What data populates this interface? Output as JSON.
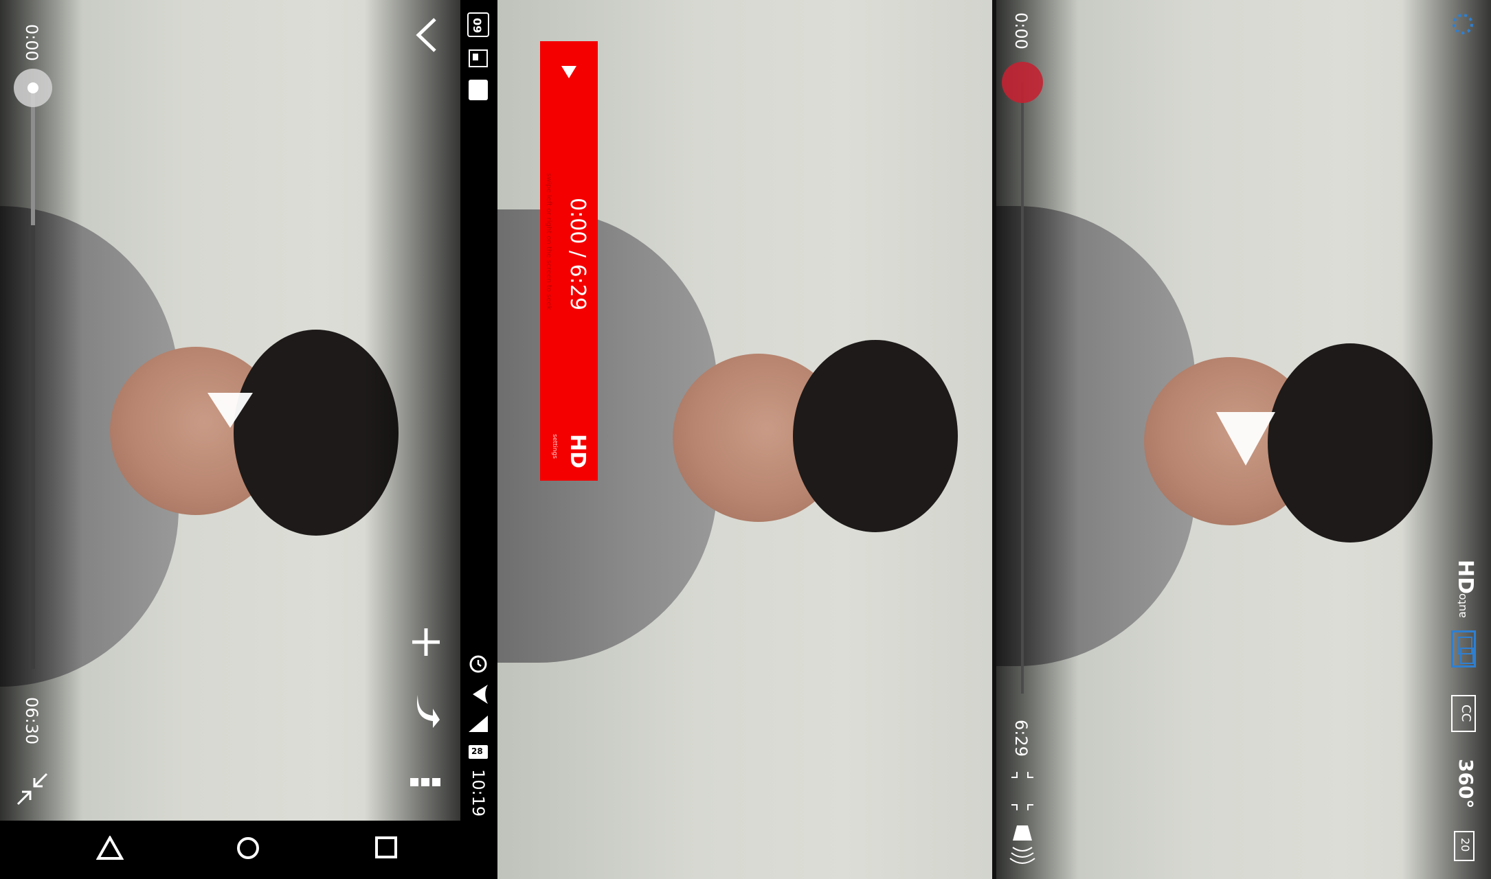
{
  "panel1": {
    "time_start": "0:00",
    "time_end": "06:30"
  },
  "panel2": {
    "status_time": "10:19",
    "status_date": "09",
    "battery": "28",
    "time_display": "0:00 / 6:29",
    "hint": "swipe left or right on the screen to seek",
    "hd_label": "HD",
    "hd_sub": "settings",
    "accent": "#f40000"
  },
  "panel3": {
    "time_start": "0:00",
    "time_end": "6:29",
    "hd_label": "HD",
    "hd_sub": "auto",
    "cc_label": "CC",
    "vr_label": "360°",
    "speed_label": "20",
    "accent": "#c32232"
  },
  "navbar": {
    "back": "back-icon",
    "home": "home-icon",
    "recents": "recents-icon"
  }
}
